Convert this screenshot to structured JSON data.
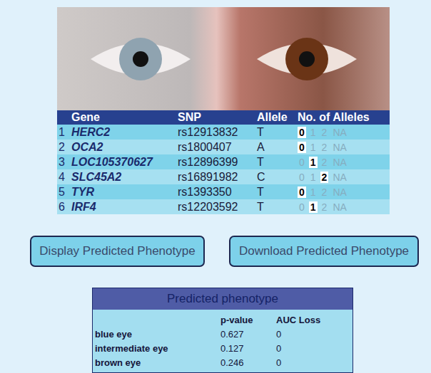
{
  "table": {
    "columns": [
      "Gene",
      "SNP",
      "Allele",
      "No. of Alleles"
    ],
    "rows": [
      {
        "index": "1",
        "gene": "HERC2",
        "snp": "rs12913832",
        "allele": "T",
        "options": [
          {
            "label": "0",
            "selected": true
          },
          {
            "label": "1",
            "selected": false
          },
          {
            "label": "2",
            "selected": false
          },
          {
            "label": "NA",
            "selected": false
          }
        ]
      },
      {
        "index": "2",
        "gene": "OCA2",
        "snp": "rs1800407",
        "allele": "A",
        "options": [
          {
            "label": "0",
            "selected": true
          },
          {
            "label": "1",
            "selected": false
          },
          {
            "label": "2",
            "selected": false
          },
          {
            "label": "NA",
            "selected": false
          }
        ]
      },
      {
        "index": "3",
        "gene": "LOC105370627",
        "snp": "rs12896399",
        "allele": "T",
        "options": [
          {
            "label": "0",
            "selected": false
          },
          {
            "label": "1",
            "selected": true
          },
          {
            "label": "2",
            "selected": false
          },
          {
            "label": "NA",
            "selected": false
          }
        ]
      },
      {
        "index": "4",
        "gene": "SLC45A2",
        "snp": "rs16891982",
        "allele": "C",
        "options": [
          {
            "label": "0",
            "selected": false
          },
          {
            "label": "1",
            "selected": false
          },
          {
            "label": "2",
            "selected": true
          },
          {
            "label": "NA",
            "selected": false
          }
        ]
      },
      {
        "index": "5",
        "gene": "TYR",
        "snp": "rs1393350",
        "allele": "T",
        "options": [
          {
            "label": "0",
            "selected": true
          },
          {
            "label": "1",
            "selected": false
          },
          {
            "label": "2",
            "selected": false
          },
          {
            "label": "NA",
            "selected": false
          }
        ]
      },
      {
        "index": "6",
        "gene": "IRF4",
        "snp": "rs12203592",
        "allele": "T",
        "options": [
          {
            "label": "0",
            "selected": false
          },
          {
            "label": "1",
            "selected": true
          },
          {
            "label": "2",
            "selected": false
          },
          {
            "label": "NA",
            "selected": false
          }
        ]
      }
    ]
  },
  "buttons": [
    "Display Predicted Phenotype",
    "Download Predicted Phenotype"
  ],
  "phenotype": {
    "title": "Predicted phenotype",
    "columns": [
      "p-value",
      "AUC Loss"
    ],
    "rows": [
      [
        "blue eye",
        "0.627",
        "0"
      ],
      [
        "intermediate eye",
        "0.127",
        "0"
      ],
      [
        "brown eye",
        "0.246",
        "0"
      ]
    ]
  }
}
